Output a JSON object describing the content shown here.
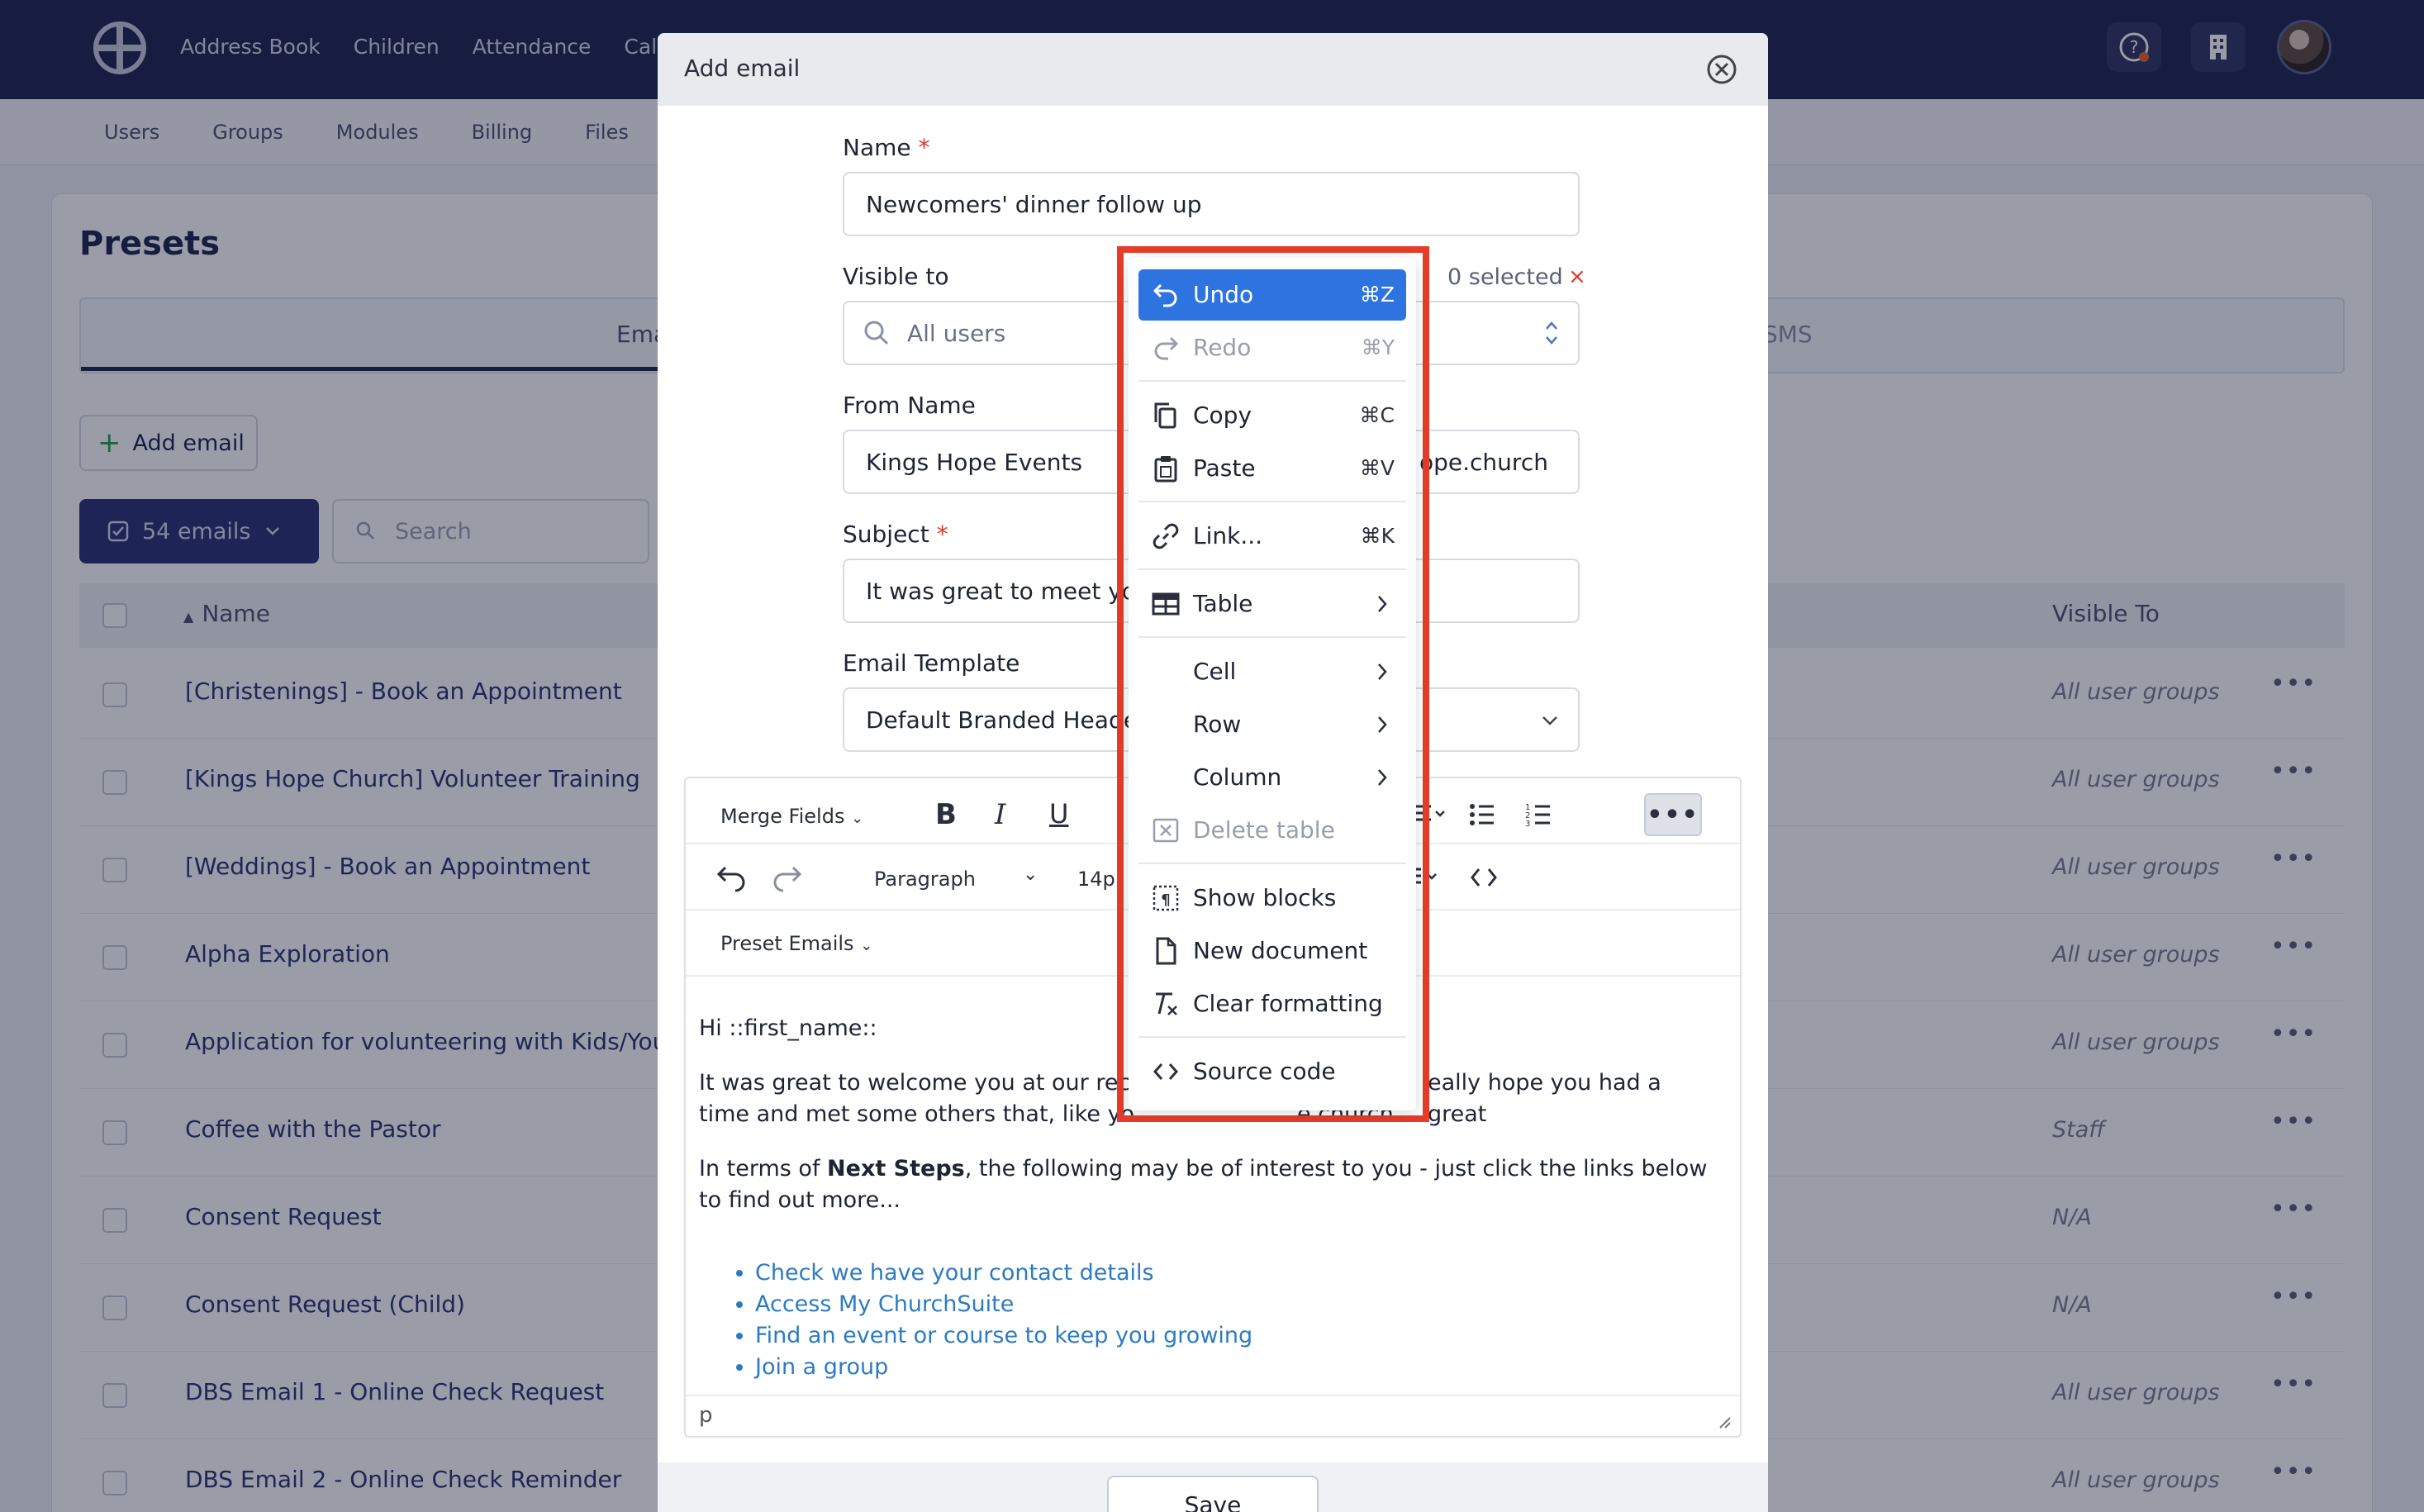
{
  "topnav": {
    "items": [
      "Address Book",
      "Children",
      "Attendance",
      "Calen"
    ]
  },
  "subnav": {
    "items": [
      "Users",
      "Groups",
      "Modules",
      "Billing",
      "Files"
    ]
  },
  "presets": {
    "title": "Presets",
    "tab_email": "Ema",
    "tab_sms": "SMS",
    "add_email_label": "Add email",
    "count_label": "54 emails",
    "search_placeholder": "Search",
    "col_name": "Name",
    "col_visible": "Visible To",
    "rows": [
      {
        "name": "[Christenings] - Book an Appointment",
        "visible": "All user groups"
      },
      {
        "name": "[Kings Hope Church] Volunteer Training",
        "visible": "All user groups"
      },
      {
        "name": "[Weddings] - Book an Appointment",
        "visible": "All user groups"
      },
      {
        "name": "Alpha Exploration",
        "visible": "All user groups"
      },
      {
        "name": "Application for volunteering with Kids/Youth",
        "visible": "All user groups"
      },
      {
        "name": "Coffee with the Pastor",
        "visible": "Staff"
      },
      {
        "name": "Consent Request",
        "visible": "N/A"
      },
      {
        "name": "Consent Request (Child)",
        "visible": "N/A"
      },
      {
        "name": "DBS Email 1 - Online Check Request",
        "visible": "All user groups"
      },
      {
        "name": "DBS Email 2 - Online Check Reminder",
        "visible": "All user groups"
      }
    ]
  },
  "modal": {
    "title": "Add email",
    "name_label": "Name",
    "name_value": "Newcomers' dinner follow up",
    "visible_label": "Visible to",
    "visible_value": "All users",
    "selected_count": "0 selected",
    "selected_clear": "×",
    "from_name_label": "From Name",
    "from_name_value": "Kings Hope Events",
    "from_email_partial": "ope.church",
    "subject_label": "Subject",
    "subject_value": "It was great to meet you!",
    "template_label": "Email Template",
    "template_value": "Default Branded Header",
    "toolbar": {
      "merge_fields": "Merge Fields",
      "paragraph": "Paragraph",
      "font_size": "14p",
      "preset_emails": "Preset Emails"
    },
    "content": {
      "greeting": "Hi ::first_name::",
      "para1_start": "It was great to welcome you at our rece",
      "para1_end": "eally hope you had a great",
      "para1_line2_start": "time and met some others that, like yo",
      "para1_line2_end": "e church.",
      "para2_prefix": "In terms of ",
      "para2_bold": "Next Steps",
      "para2_suffix": ", the following may be of interest to you - just click the links below to find out more...",
      "links": [
        "Check we have your contact details",
        "Access My ChurchSuite",
        "Find an event or course to keep you growing",
        "Join a group"
      ]
    },
    "status_path": "p",
    "save_label": "Save"
  },
  "context_menu": {
    "undo": {
      "label": "Undo",
      "shortcut": "⌘Z"
    },
    "redo": {
      "label": "Redo",
      "shortcut": "⌘Y"
    },
    "copy": {
      "label": "Copy",
      "shortcut": "⌘C"
    },
    "paste": {
      "label": "Paste",
      "shortcut": "⌘V"
    },
    "link": {
      "label": "Link...",
      "shortcut": "⌘K"
    },
    "table": {
      "label": "Table"
    },
    "cell": {
      "label": "Cell"
    },
    "row": {
      "label": "Row"
    },
    "column": {
      "label": "Column"
    },
    "delete_table": {
      "label": "Delete table"
    },
    "show_blocks": {
      "label": "Show blocks"
    },
    "new_document": {
      "label": "New document"
    },
    "clear_formatting": {
      "label": "Clear formatting"
    },
    "source_code": {
      "label": "Source code"
    }
  },
  "colors": {
    "topbar": "#1e2550",
    "accent": "#2e74e0",
    "highlight_frame": "#e53d2a",
    "required": "#d9392b",
    "link": "#2c7bc2"
  }
}
